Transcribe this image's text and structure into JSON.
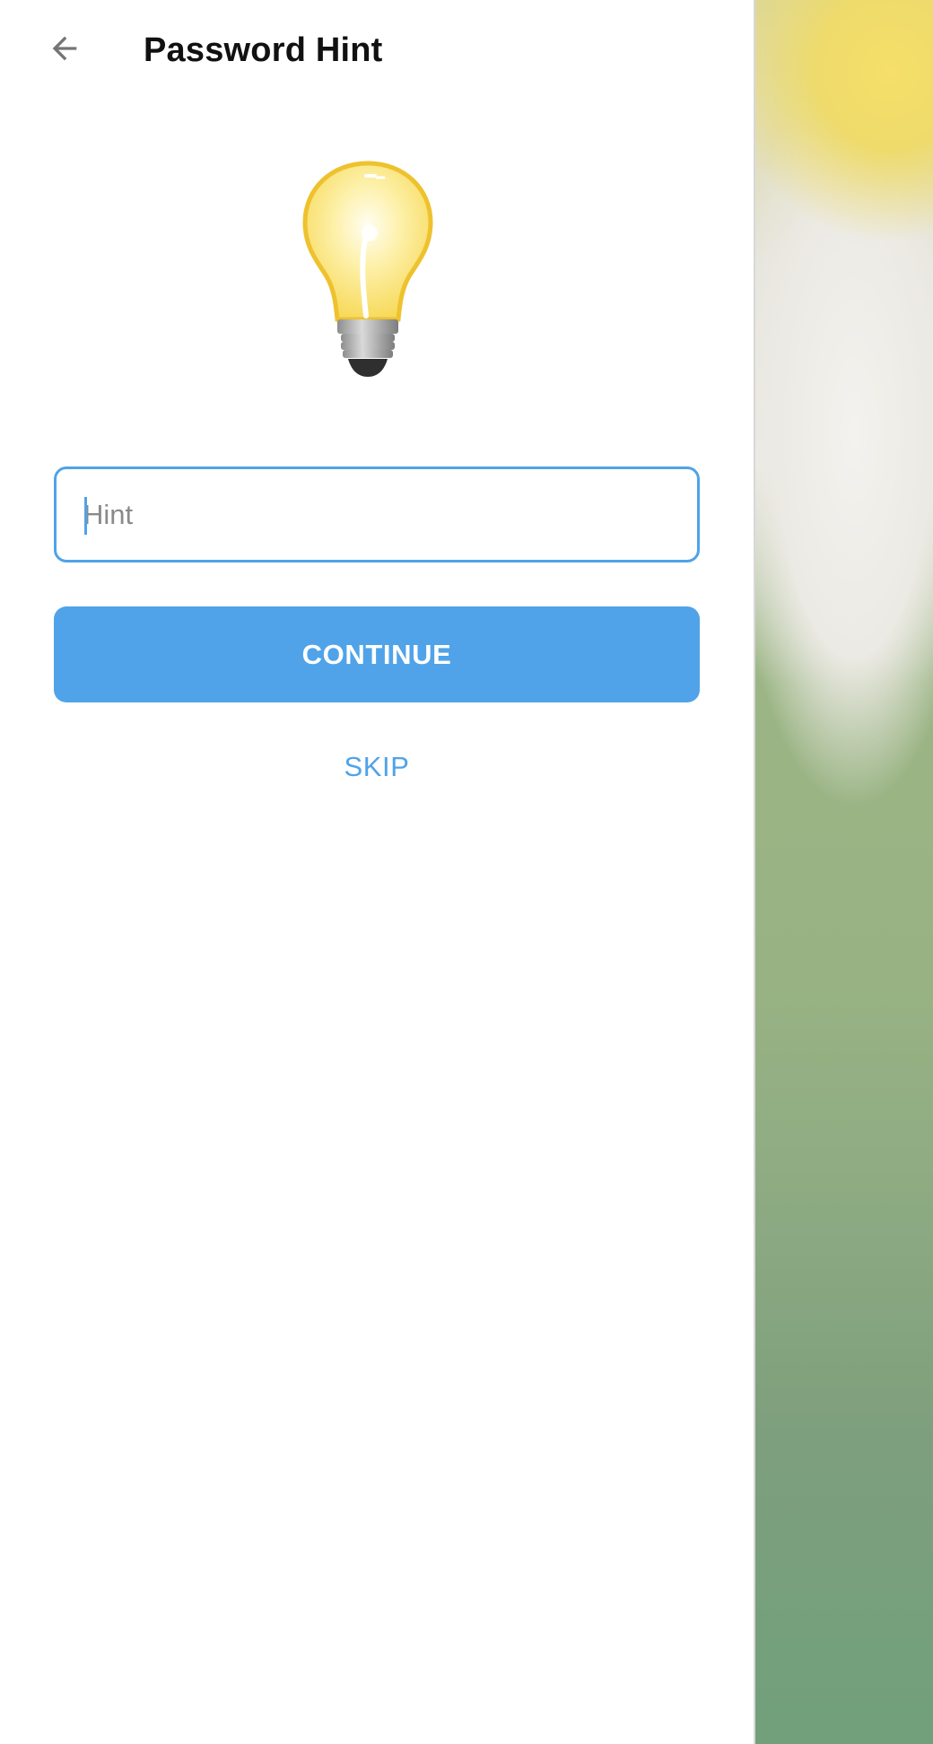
{
  "header": {
    "title": "Password Hint",
    "back_icon": "arrow-left-icon"
  },
  "illustration": {
    "icon": "lightbulb-icon"
  },
  "hint_input": {
    "value": "",
    "placeholder": "Hint"
  },
  "actions": {
    "continue_label": "CONTINUE",
    "skip_label": "SKIP"
  },
  "colors": {
    "accent": "#50a3e9",
    "title_text": "#111111",
    "placeholder_text": "#8a8a8a"
  }
}
